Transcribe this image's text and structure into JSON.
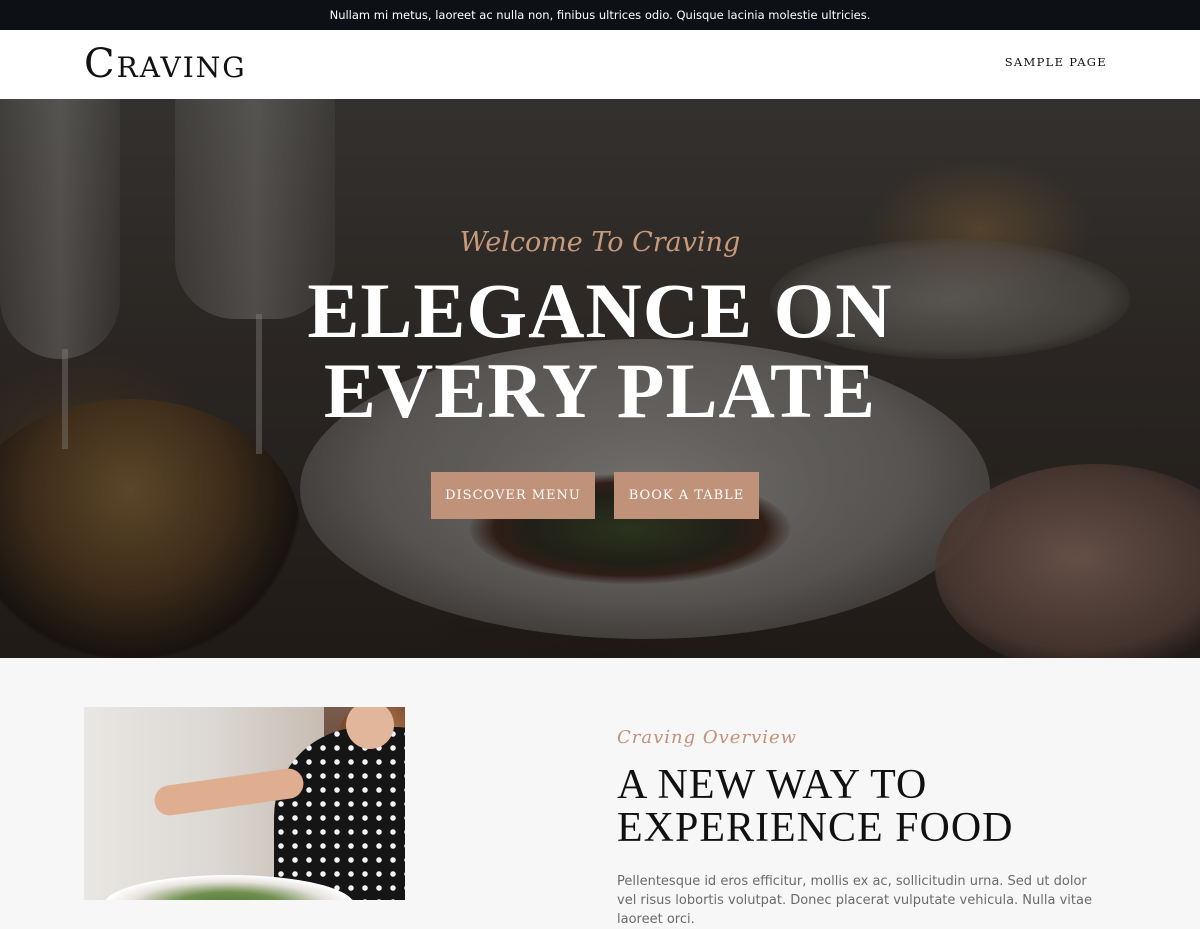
{
  "topbar": {
    "text": "Nullam mi metus, laoreet ac nulla non, finibus ultrices odio. Quisque lacinia molestie ultricies."
  },
  "header": {
    "logo": "Craving",
    "nav": [
      {
        "label": "Sample Page"
      }
    ]
  },
  "hero": {
    "kicker": "Welcome To Craving",
    "title_line1": "Elegance on",
    "title_line2": "every plate",
    "buttons": {
      "menu": "Discover Menu",
      "table": "Book a Table"
    }
  },
  "overview": {
    "kicker": "Craving Overview",
    "heading_line1": "A new way to",
    "heading_line2": "experience food",
    "paragraph": "Pellentesque id eros efficitur, mollis ex ac, sollicitudin urna. Sed ut dolor vel risus lobortis volutpat. Donec placerat vulputate vehicula. Nulla vitae laoreet orci."
  },
  "colors": {
    "accent": "#c0927a",
    "topbar_bg": "#0d1015",
    "section_bg": "#f7f7f7"
  }
}
